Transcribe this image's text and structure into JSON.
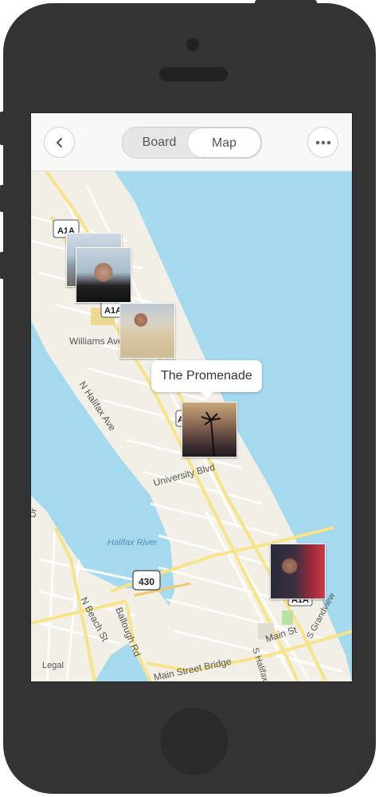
{
  "header": {
    "back_icon": "chevron-left-icon",
    "more_icon": "ellipsis-icon",
    "tabs": [
      {
        "label": "Board",
        "active": false
      },
      {
        "label": "Map",
        "active": true
      }
    ]
  },
  "map": {
    "labels": {
      "williams": "Williams Ave",
      "halifax_ave": "N Halifax Ave",
      "university": "University Blvd",
      "halifax_river": "Halifax River",
      "beach_st": "N Beach St",
      "ballough": "Ballough Rd",
      "main_st": "Main St",
      "main_bridge": "Main Street Bridge",
      "s_halifax": "S Halifax",
      "grandview": "S Grandview",
      "dr": "Dr"
    },
    "shields": {
      "a1a_1": "A1A",
      "a1a_2": "A1A",
      "a1a_3": "A",
      "a1a_4": "A1A",
      "route_430": "430"
    },
    "callout": "The Promenade",
    "legal": "Legal"
  },
  "colors": {
    "water": "#a4d9ee",
    "land": "#f2efe6",
    "road_major": "#f7e38a",
    "road_minor": "#ffffff",
    "phone_body": "#333333"
  }
}
